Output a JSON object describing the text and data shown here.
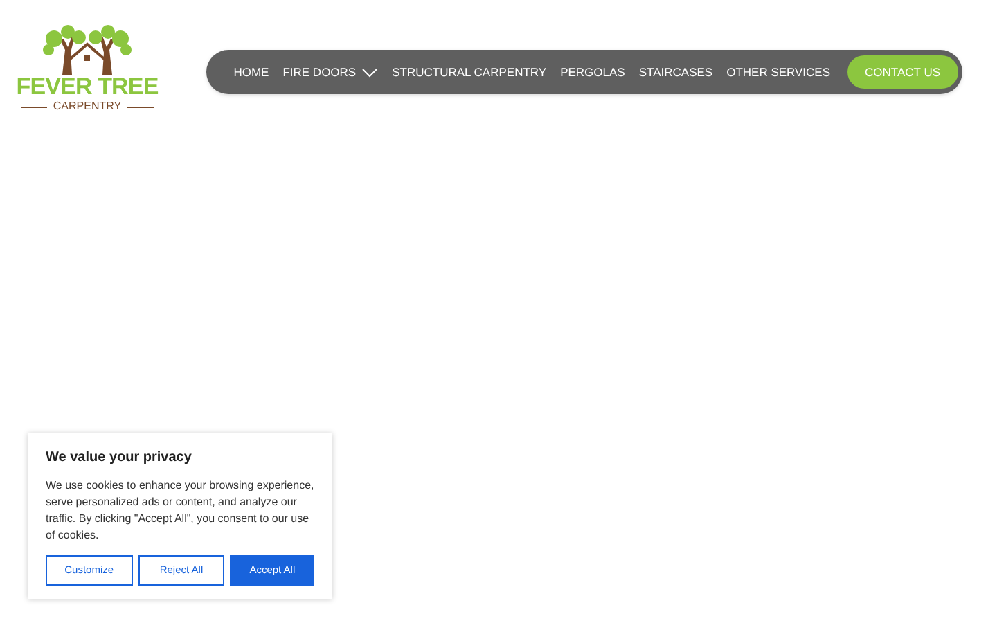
{
  "logo": {
    "title": "FEVER TREE",
    "subtitle": "CARPENTRY"
  },
  "nav": {
    "items": [
      {
        "label": "HOME",
        "dropdown": false
      },
      {
        "label": "FIRE DOORS",
        "dropdown": true
      },
      {
        "label": "STRUCTURAL CARPENTRY",
        "dropdown": false
      },
      {
        "label": "PERGOLAS",
        "dropdown": false
      },
      {
        "label": "STAIRCASES",
        "dropdown": false
      },
      {
        "label": "OTHER SERVICES",
        "dropdown": false
      }
    ],
    "cta": "CONTACT US"
  },
  "cookie_banner": {
    "title": "We value your privacy",
    "text": "We use cookies to enhance your browsing experience, serve personalized ads or content, and analyze our traffic. By clicking \"Accept All\", you consent to our use of cookies.",
    "buttons": [
      {
        "label": "Customize",
        "kind": "outline"
      },
      {
        "label": "Reject All",
        "kind": "outline"
      },
      {
        "label": "Accept All",
        "kind": "primary"
      }
    ]
  }
}
